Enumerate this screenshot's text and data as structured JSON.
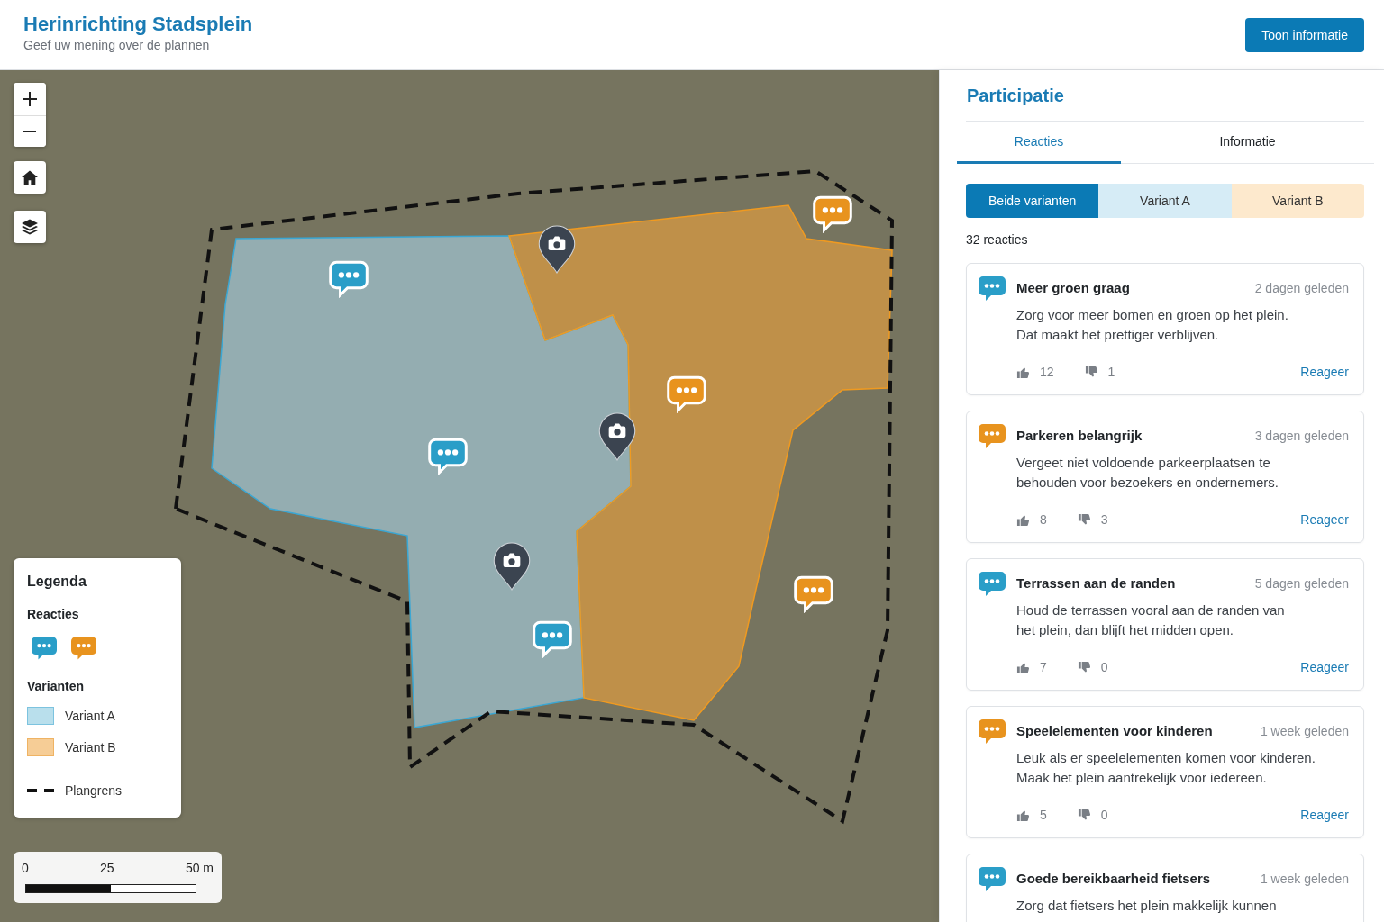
{
  "header": {
    "title": "Herinrichting Stadsplein",
    "subtitle": "Geef uw mening over de plannen",
    "button": "Toon informatie"
  },
  "map": {
    "markers": [
      {
        "kind": "comment",
        "color": "#e8931e"
      },
      {
        "kind": "photo"
      },
      {
        "kind": "comment",
        "color": "#2a9ec8"
      },
      {
        "kind": "comment",
        "color": "#e8931e"
      },
      {
        "kind": "photo"
      },
      {
        "kind": "comment",
        "color": "#2a9ec8"
      },
      {
        "kind": "photo"
      },
      {
        "kind": "comment",
        "color": "#e8931e"
      },
      {
        "kind": "comment",
        "color": "#2a9ec8"
      }
    ],
    "legend": {
      "title": "Legenda",
      "reactions": {
        "heading": "Reacties",
        "icons": [
          {
            "color": "#2a9ec8"
          },
          {
            "color": "#e8931e"
          }
        ]
      },
      "variants": {
        "heading": "Varianten",
        "items": [
          {
            "label": "Variant A",
            "color": "#b9dfec"
          },
          {
            "label": "Variant B",
            "color": "#f6cd96"
          }
        ]
      },
      "boundary": {
        "label": "Plangrens"
      }
    },
    "scale_bar": {
      "labels": [
        "0",
        "25",
        "50 m"
      ]
    }
  },
  "panel": {
    "title": "Participatie",
    "tabs": [
      {
        "label": "Reacties",
        "selected": true
      },
      {
        "label": "Informatie",
        "selected": false
      }
    ],
    "filters": [
      {
        "label": "Beide varianten",
        "selected": true
      },
      {
        "label": "Variant A",
        "selected": false,
        "color": "#d6ecf6"
      },
      {
        "label": "Variant B",
        "selected": false,
        "color": "#fde9cd"
      }
    ],
    "count": "32 reacties",
    "comments": [
      {
        "title": "Meer groen graag",
        "time": "2 dagen geleden",
        "body": [
          "Zorg voor meer bomen en groen op het plein.",
          "Dat maakt het prettiger verblijven."
        ],
        "likes": "12",
        "dislikes": "1",
        "action": "Reageer",
        "color": "#2a9ec8"
      },
      {
        "title": "Parkeren belangrijk",
        "time": "3 dagen geleden",
        "body": [
          "Vergeet niet voldoende parkeerplaatsen te",
          "behouden voor bezoekers en ondernemers."
        ],
        "likes": "8",
        "dislikes": "3",
        "action": "Reageer",
        "color": "#e8931e"
      },
      {
        "title": "Terrassen aan de randen",
        "time": "5 dagen geleden",
        "body": [
          "Houd de terrassen vooral aan de randen van",
          "het plein, dan blijft het midden open."
        ],
        "likes": "7",
        "dislikes": "0",
        "action": "Reageer",
        "color": "#2a9ec8"
      },
      {
        "title": "Speelelementen voor kinderen",
        "time": "1 week geleden",
        "body": [
          "Leuk als er speelelementen komen voor kinderen.",
          "Maak het plein aantrekelijk voor iedereen."
        ],
        "likes": "5",
        "dislikes": "0",
        "action": "Reageer",
        "color": "#e8931e"
      },
      {
        "title": "Goede bereikbaarheid fietsers",
        "time": "1 week geleden",
        "body": [
          "Zorg dat fietsers het plein makkelijk kunnen"
        ],
        "color": "#2a9ec8"
      }
    ]
  }
}
